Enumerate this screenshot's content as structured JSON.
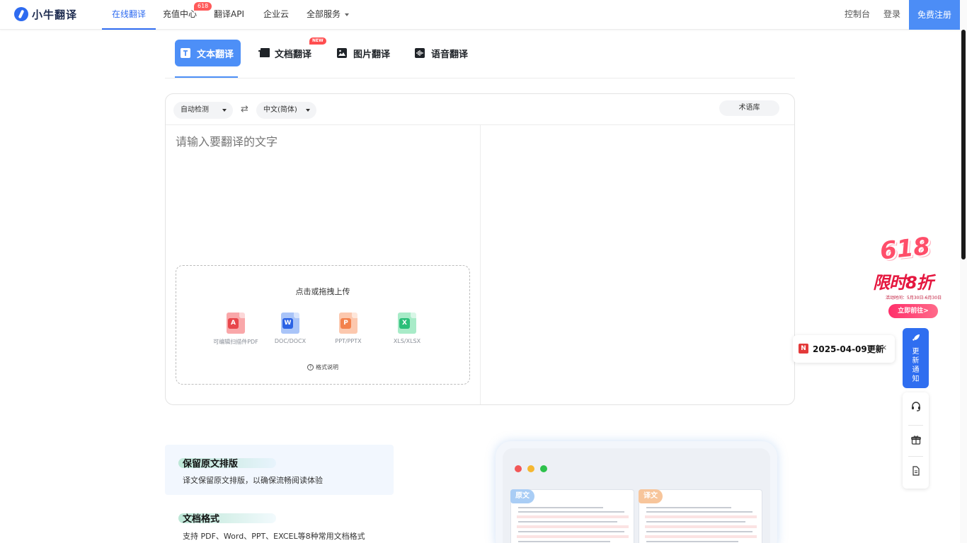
{
  "brand": {
    "name": "小牛翻译"
  },
  "nav": {
    "items": [
      {
        "label": "在线翻译",
        "active": true
      },
      {
        "label": "充值中心",
        "badge": "618"
      },
      {
        "label": "翻译API"
      },
      {
        "label": "企业云"
      },
      {
        "label": "全部服务",
        "dropdown": true
      }
    ],
    "console": "控制台",
    "login": "登录",
    "register": "免费注册"
  },
  "tabs": [
    {
      "label": "文本翻译",
      "icon": "text-t-icon",
      "active": true
    },
    {
      "label": "文档翻译",
      "icon": "folder-icon",
      "badge": "NEW"
    },
    {
      "label": "图片翻译",
      "icon": "image-icon"
    },
    {
      "label": "语音翻译",
      "icon": "voice-icon"
    }
  ],
  "translator": {
    "source_lang": "自动检测",
    "target_lang": "中文(简体)",
    "swap_icon": "swap-arrows-icon",
    "term_lib": "术语库",
    "placeholder": "请输入要翻译的文字",
    "upload": {
      "title": "点击或拖拽上传",
      "formats": [
        {
          "label": "可编辑扫描件PDF",
          "icon": "pdf-icon",
          "color": "#e8464b",
          "bg": "#f9a7a9"
        },
        {
          "label": "DOC/DOCX",
          "icon": "word-icon",
          "color": "#2c63e5",
          "bg": "#a9c4f8"
        },
        {
          "label": "PPT/PPTX",
          "icon": "ppt-icon",
          "color": "#f3824d",
          "bg": "#fcc8ae"
        },
        {
          "label": "XLS/XLSX",
          "icon": "excel-icon",
          "color": "#2bbf79",
          "bg": "#a8ebc8"
        }
      ],
      "help": "格式说明"
    }
  },
  "features": [
    {
      "title": "保留原文排版",
      "desc": "译文保留原文排版，以确保流畅阅读体验"
    },
    {
      "title": "文档格式",
      "desc": "支持 PDF、Word、PPT、EXCEL等8种常用文档格式"
    }
  ],
  "preview": {
    "source_tag": "原文",
    "target_tag": "译文",
    "window_dots": [
      "#f25757",
      "#f5b731",
      "#2dc14b"
    ]
  },
  "promo": {
    "big": "618",
    "main": "限时8折",
    "sub": "活动时间：5月30日-6月30日",
    "cta": "立即前往>"
  },
  "update": {
    "text": "2025-04-09更新",
    "close": "×",
    "notify_label": "更新通知"
  },
  "tools": [
    "headset-icon",
    "gift-icon",
    "document-icon"
  ],
  "colors": {
    "accent": "#4d8ff7",
    "brand_blue": "#2e6bf0"
  }
}
